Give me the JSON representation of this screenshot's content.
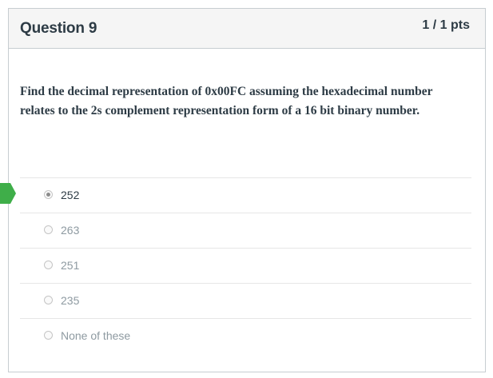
{
  "question": {
    "title": "Question 9",
    "points": "1 / 1 pts",
    "text": "Find the decimal representation of 0x00FC assuming the hexadecimal number relates to the 2s complement representation form of a 16 bit binary number."
  },
  "answers": [
    {
      "label": "252",
      "selected": true
    },
    {
      "label": "263",
      "selected": false
    },
    {
      "label": "251",
      "selected": false
    },
    {
      "label": "235",
      "selected": false
    },
    {
      "label": "None of these",
      "selected": false
    }
  ],
  "colors": {
    "correct_marker": "#3fae49",
    "header_bg": "#f5f5f5",
    "text": "#2d3b45",
    "muted_text": "#8e9aa1"
  }
}
